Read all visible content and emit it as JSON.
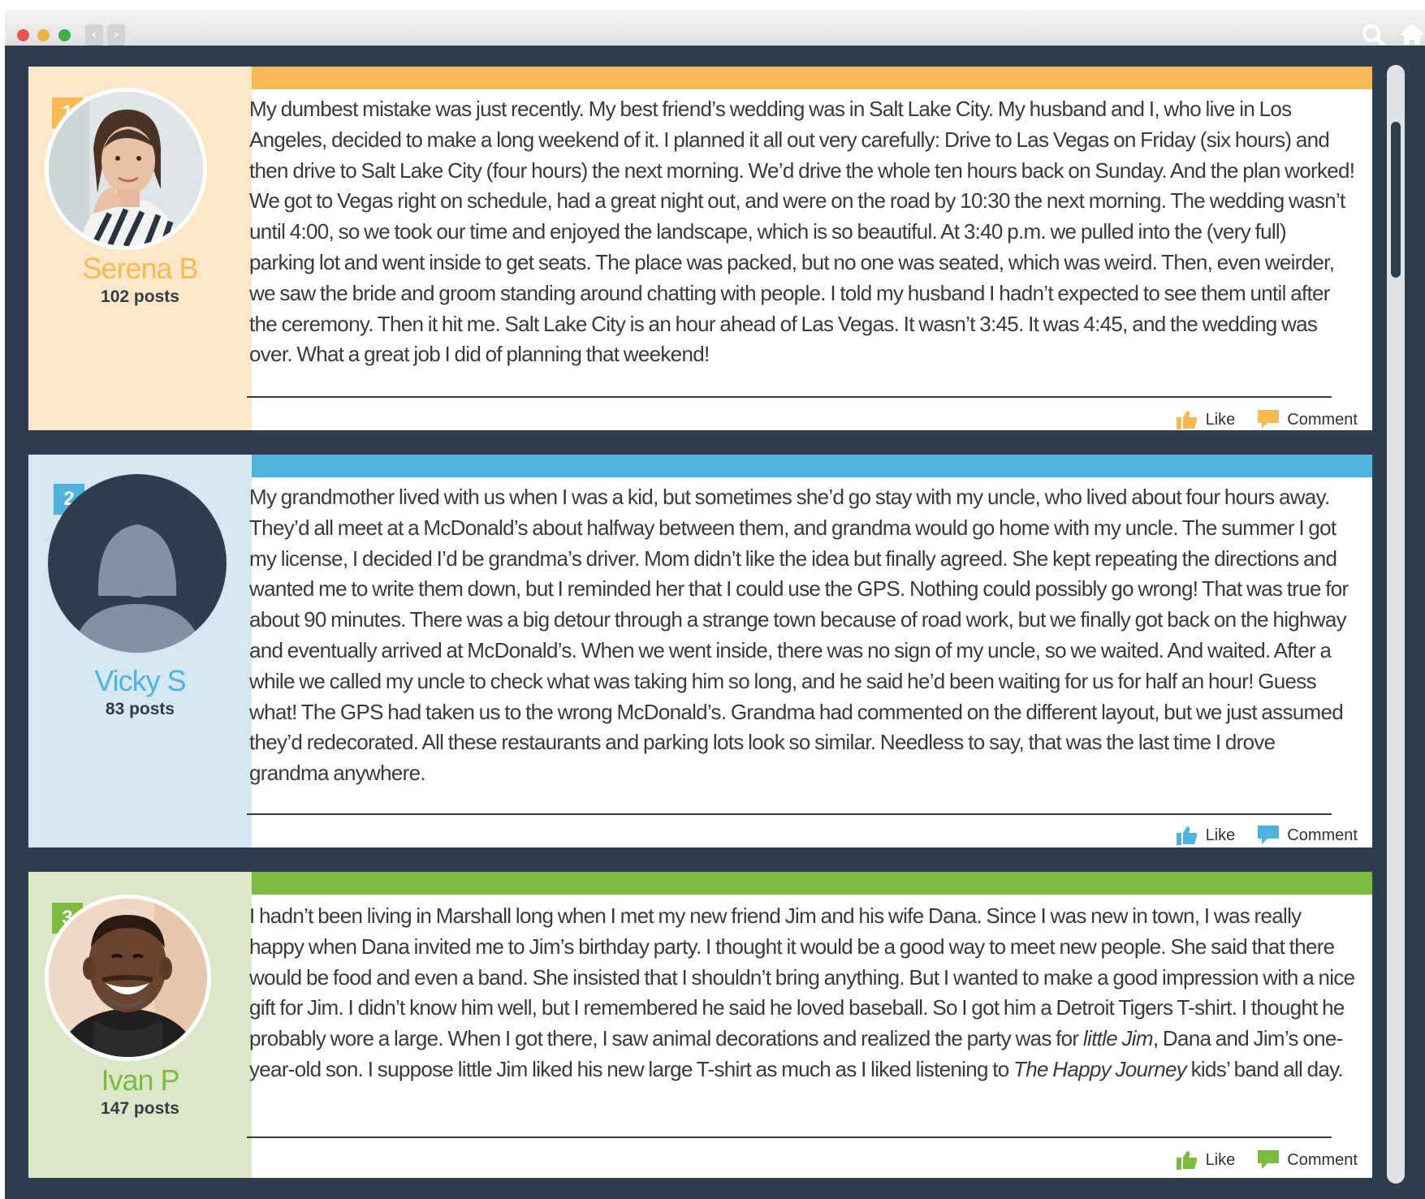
{
  "browser": {
    "back_icon": "chevron-left",
    "forward_icon": "chevron-right"
  },
  "colors": {
    "frame": "#2f3e4c",
    "orange": "#f6b955",
    "orange_light": "#fde7c8",
    "blue": "#4fb2dc",
    "blue_light": "#d4e7f2",
    "green": "#7bb93f",
    "green_light": "#dde7c8"
  },
  "actions": {
    "like_label": "Like",
    "comment_label": "Comment"
  },
  "posts": [
    {
      "rank": "1",
      "name": "Serena B",
      "post_count": "102 posts",
      "text": "My dumbest mistake was just recently. My best friend’s wedding was in Salt Lake City. My husband and I, who live in Los Angeles, decided to make a long weekend of it. I planned it all out very carefully: Drive to Las Vegas on Friday (six hours) and then drive to Salt Lake City (four hours) the next morning. We’d drive the whole ten hours back on Sunday. And the plan worked! We got to Vegas right on schedule, had a great night out, and were on the road by 10:30 the next morning. The wedding wasn’t until 4:00, so we took our time and enjoyed the landscape, which is so beautiful. At 3:40 p.m. we pulled into the (very full) parking lot and went inside to get seats. The place was packed, but no one was seated, which was weird. Then, even weirder, we saw the bride and groom standing around chatting with people. I told my husband I hadn’t expected to see them until after the ceremony. Then it hit me. Salt Lake City is an hour ahead of Las Vegas. It wasn’t 3:45. It was 4:45, and the wedding was over. What a great job I did of planning that weekend!"
    },
    {
      "rank": "2",
      "name": "Vicky S",
      "post_count": "83 posts",
      "text": "My grandmother lived with us when I was a kid, but sometimes she’d go stay with my uncle, who lived about four hours away. They’d all meet at a McDonald’s about halfway between them, and grandma would go home with my uncle. The summer I got my license, I decided I’d be grandma’s driver. Mom didn’t like the idea but finally agreed. She kept repeating the directions and wanted me to write them down, but I reminded her that I could use the GPS. Nothing could possibly go wrong! That was true for about 90 minutes. There was a big detour through a strange town because of road work, but we finally got back on the highway and eventually arrived at McDonald’s. When we went inside, there was no sign of my uncle, so we waited. And waited. After a while we called my uncle to check what was taking him so long, and he said he’d been waiting for us for half an hour! Guess what! The GPS had taken us to the wrong McDonald’s. Grandma had commented on the different layout, but we just assumed they’d redecorated. All these restaurants and parking lots look so similar. Needless to say, that was the last time I drove grandma anywhere."
    },
    {
      "rank": "3",
      "name": "Ivan P",
      "post_count": "147 posts",
      "text_before": "I hadn’t been living in Marshall long when I met my new friend Jim and his wife Dana. Since I was new in town, I was really happy when Dana invited me to Jim’s birthday party. I thought it would be a good way to meet new people. She said that there would be food and even a band. She insisted that I shouldn’t bring anything. But I wanted to make a good impression with a nice gift for Jim. I didn’t know him well, but I remembered he said he loved baseball. So I got him a Detroit Tigers T-shirt. I thought he probably wore a large. When I got there, I saw animal decorations and realized the party was for ",
      "text_italic_1": "little Jim",
      "text_middle": ", Dana and Jim’s one-year-old son. I suppose little Jim liked his new large T-shirt as much as I liked listening to ",
      "text_italic_2": "The Happy Journey",
      "text_after": " kids’ band all day."
    }
  ]
}
